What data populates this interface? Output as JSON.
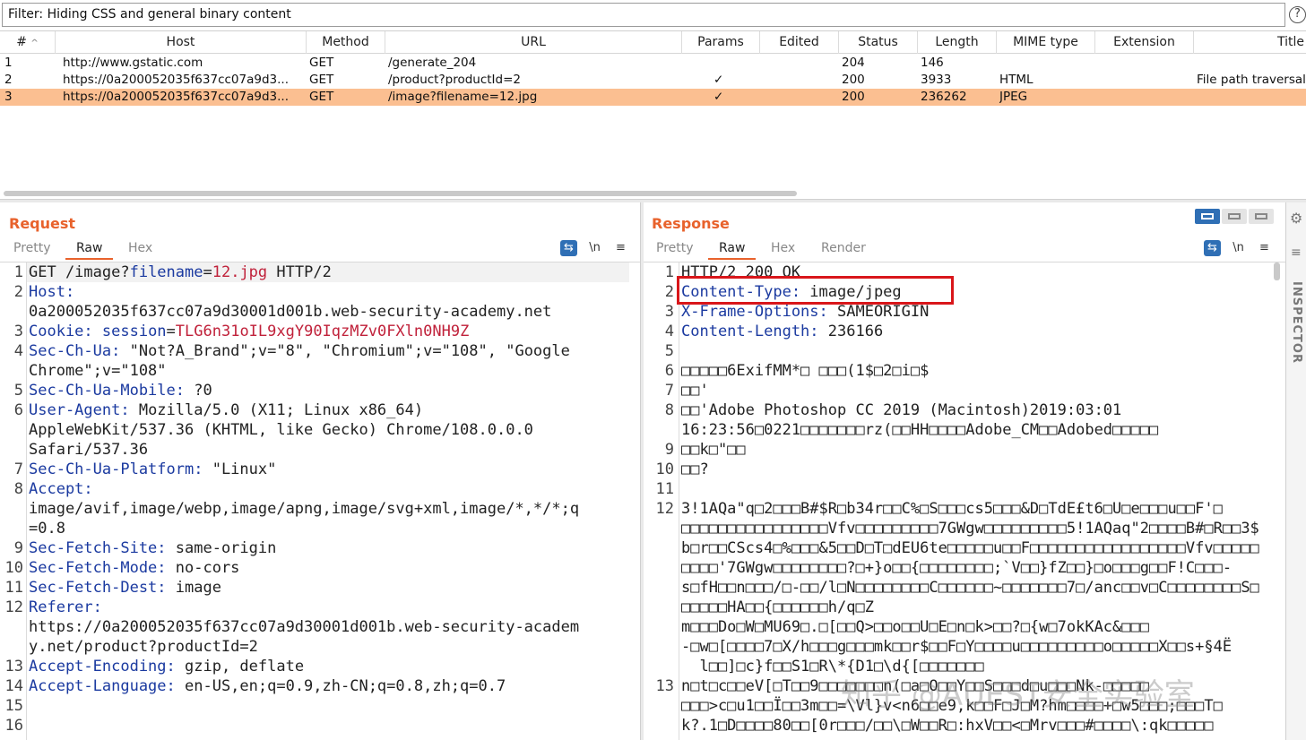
{
  "filter": {
    "text": "Filter: Hiding CSS and general binary content",
    "help": "?"
  },
  "table": {
    "columns": [
      "#",
      "Host",
      "Method",
      "URL",
      "Params",
      "Edited",
      "Status",
      "Length",
      "MIME type",
      "Extension",
      "Title"
    ],
    "sort_indicator": "^",
    "rows": [
      {
        "num": "1",
        "host": "http://www.gstatic.com",
        "method": "GET",
        "url": "/generate_204",
        "params": "",
        "edited": "",
        "status": "204",
        "length": "146",
        "mime": "",
        "ext": "",
        "title": ""
      },
      {
        "num": "2",
        "host": "https://0a200052035f637cc07a9d3...",
        "method": "GET",
        "url": "/product?productId=2",
        "params": "✓",
        "edited": "",
        "status": "200",
        "length": "3933",
        "mime": "HTML",
        "ext": "",
        "title": "File path traversal,"
      },
      {
        "num": "3",
        "host": "https://0a200052035f637cc07a9d3...",
        "method": "GET",
        "url": "/image?filename=12.jpg",
        "params": "✓",
        "edited": "",
        "status": "200",
        "length": "236262",
        "mime": "JPEG",
        "ext": "",
        "title": ""
      }
    ],
    "selected_row": 3
  },
  "request": {
    "title": "Request",
    "tabs": [
      "Pretty",
      "Raw",
      "Hex"
    ],
    "active_tab": "Raw",
    "tools": {
      "wrap": "⇆",
      "newline": "\\n",
      "menu": "≡"
    },
    "line_numbers": [
      "1",
      "2",
      "3",
      "4",
      "5",
      "6",
      "7",
      "8",
      "9",
      "10",
      "11",
      "12",
      "13",
      "14",
      "15",
      "16"
    ],
    "lines": {
      "l1_method": "GET /image?",
      "l1_param": "filename",
      "l1_eq": "=",
      "l1_val": "12.jpg",
      "l1_rest": " HTTP/2",
      "host_k": "Host:",
      "host_v": "0a200052035f637cc07a9d30001d001b.web-security-academy.net",
      "cookie_k": "Cookie:",
      "cookie_name": " session",
      "cookie_eq": "=",
      "cookie_v": "TLG6n31oIL9xgY90IqzMZv0FXln0NH9Z",
      "chua_k": "Sec-Ch-Ua:",
      "chua_v1": " \"Not?A_Brand\";v=\"8\", \"Chromium\";v=\"108\", \"Google",
      "chua_v2": "Chrome\";v=\"108\"",
      "mobile_k": "Sec-Ch-Ua-Mobile:",
      "mobile_v": " ?0",
      "ua_k": "User-Agent:",
      "ua_v1": " Mozilla/5.0 (X11; Linux x86_64)",
      "ua_v2": "AppleWebKit/537.36 (KHTML, like Gecko) Chrome/108.0.0.0",
      "ua_v3": "Safari/537.36",
      "platform_k": "Sec-Ch-Ua-Platform:",
      "platform_v": " \"Linux\"",
      "accept_k": "Accept:",
      "accept_v1": "image/avif,image/webp,image/apng,image/svg+xml,image/*,*/*;q",
      "accept_v2": "=0.8",
      "site_k": "Sec-Fetch-Site:",
      "site_v": " same-origin",
      "mode_k": "Sec-Fetch-Mode:",
      "mode_v": " no-cors",
      "dest_k": "Sec-Fetch-Dest:",
      "dest_v": " image",
      "referer_k": "Referer:",
      "referer_v1": "https://0a200052035f637cc07a9d30001d001b.web-security-academ",
      "referer_v2": "y.net/product?productId=2",
      "enc_k": "Accept-Encoding:",
      "enc_v": " gzip, deflate",
      "lang_k": "Accept-Language:",
      "lang_v": " en-US,en;q=0.9,zh-CN;q=0.8,zh;q=0.7"
    }
  },
  "response": {
    "title": "Response",
    "tabs": [
      "Pretty",
      "Raw",
      "Hex",
      "Render"
    ],
    "active_tab": "Raw",
    "tools": {
      "wrap": "⇆",
      "newline": "\\n",
      "menu": "≡"
    },
    "line_numbers": [
      "1",
      "2",
      "3",
      "4",
      "5",
      "6",
      "7",
      "8",
      "9",
      "10",
      "11",
      "12",
      "13"
    ],
    "lines": {
      "status": "HTTP/2 200 OK",
      "ct_k": "Content-Type:",
      "ct_v": " image/jpeg",
      "xfo_k": "X-Frame-Options:",
      "xfo_v": " SAMEORIGIN",
      "cl_k": "Content-Length:",
      "cl_v": " 236166",
      "b6": "□□□□□6ExifMM*□ □□□(1$□2□i□$",
      "b7": "□□'",
      "b8a": "□□'Adobe Photoshop CC 2019 (Macintosh)2019:03:01",
      "b8b": "16:23:56□0221□□□□□□□rz(□□HH□□□□Adobe_CM□□Adobed□□□□□",
      "b9": "□□k□\"□□",
      "b10": "□□?",
      "b12a": "3!1AQa\"q□2□□□B#$R□b34r□□C%□S□□□cs5□□□&D□TdE£t6□U□e□□□u□□F'□",
      "b12b": "□□□□□□□□□□□□□□□□Vfv□□□□□□□□□7GWgw□□□□□□□□□5!1AQaq\"2□□□□B#□R□□3$",
      "b12c": "b□r□□CScs4□%□□□&5□□D□T□dEU6te□□□□□u□□F□□□□□□□□□□□□□□□□□Vfv□□□□□",
      "b12d": "□□□□'7GWgw□□□□□□□□?□+}o□□{□□□□□□□□;`V□□}fZ□□}□o□□□g□□F!C□□□-",
      "b12e": "s□fH□□n□□□/□-□□/l□N□□□□□□□□C□□□□□□~□□□□□□□7□/anc□□v□C□□□□□□□□S□",
      "b12f": "□□□□□HA□□{□□□□□□h/q□Z",
      "b12g": "m□□□Do□W□MU69□.□[□□Q>□□o□□U□E□n□k>□□?□{w□7okKAc&□□□",
      "b12h": "-□w□[□□□□7□X/h□□□g□□□mk□□r$□□F□Y□□□□u□□□□□□□□□o□□□□□X□□s+§4Ë",
      "b12i": "  l□□]□c}f□□S1□R\\*{D1□\\d{[□□□□□□□",
      "b13a": "n□t□c□□eV[□T□□9□□□□□□□n(□a□O□□Y□□S□□□d□u□□□Nk-□□□□□",
      "b13b": "□□□>c□u1□□Ï□□3m□□=\\Vl}v<n6□□e9,k□□F□J□M?hm□□□□+□w5□□□;□□□T□",
      "b13c": "k?.1□D□□□□80□□[0r□□□/□□\\□W□□R□:hxV□□<□Mrv□□□#□□□□\\:qk□□□□□",
      "b14": "□□□□□□□□□□□□□□□□□□□□□□□□□□□□□□□□□□□□□□□□□□□□□□□□□□□□□□□"
    }
  },
  "inspector": {
    "label": "INSPECTOR"
  },
  "watermark": {
    "text": "知乎 @AUEST安全实验室"
  }
}
